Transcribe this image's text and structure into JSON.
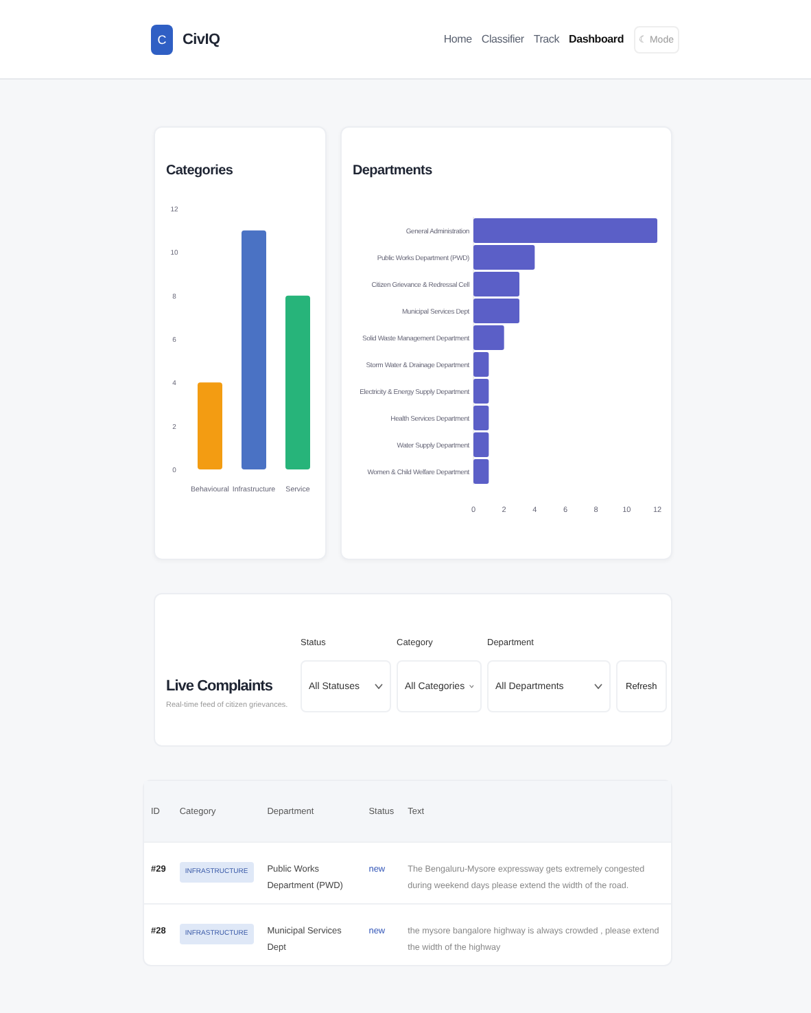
{
  "header": {
    "logo_letter": "C",
    "brand": "CivIQ",
    "nav": [
      {
        "label": "Home",
        "selected": false
      },
      {
        "label": "Classifier",
        "selected": false
      },
      {
        "label": "Track",
        "selected": false
      },
      {
        "label": "Dashboard",
        "selected": true
      }
    ],
    "mode_button": "☾ Mode"
  },
  "categories_chart": {
    "chart_data": {
      "type": "bar",
      "title": "Categories",
      "categories": [
        "Behavioural",
        "Infrastructure",
        "Service"
      ],
      "series": [
        {
          "color": "#f39c12",
          "values": [
            4,
            null,
            null
          ]
        },
        {
          "color": "#4a72c4",
          "values": [
            null,
            11,
            null
          ]
        },
        {
          "color": "#27b47a",
          "values": [
            null,
            null,
            8
          ]
        }
      ],
      "ylim": [
        0,
        12
      ],
      "yticks": [
        0,
        2,
        4,
        6,
        8,
        10,
        12
      ]
    }
  },
  "departments_chart": {
    "chart_data": {
      "type": "bar",
      "orientation": "horizontal",
      "title": "Departments",
      "categories": [
        "General Administration",
        "Public Works Department (PWD)",
        "Citizen Grievance & Redressal Cell",
        "Municipal Services Dept",
        "Solid Waste Management Department",
        "Storm Water & Drainage Department",
        "Electricity & Energy Supply Department",
        "Health Services Department",
        "Water Supply Department",
        "Women & Child Welfare Department"
      ],
      "series": [
        {
          "color": "#5b5fc7",
          "values": [
            12,
            4,
            3,
            3,
            2,
            1,
            1,
            1,
            1,
            1
          ]
        }
      ],
      "xlim": [
        0,
        12
      ],
      "xticks": [
        0,
        2,
        4,
        6,
        8,
        10,
        12
      ]
    }
  },
  "live": {
    "title": "Live Complaints",
    "subtitle": "Real-time feed of citizen grievances.",
    "filters": [
      {
        "label": "Status",
        "value": "All Statuses"
      },
      {
        "label": "Category",
        "value": "All Categories"
      },
      {
        "label": "Department",
        "value": "All Departments"
      }
    ],
    "refresh": "Refresh"
  },
  "table": {
    "columns": [
      "ID",
      "Category",
      "Department",
      "Status",
      "Text"
    ],
    "rows": [
      {
        "id": "#29",
        "category": "INFRASTRUCTURE",
        "department": "Public Works Department (PWD)",
        "status": "new",
        "text": "The Bengaluru-Mysore expressway gets extremely congested during weekend days please extend the width of the road."
      },
      {
        "id": "#28",
        "category": "INFRASTRUCTURE",
        "department": "Municipal Services Dept",
        "status": "new",
        "text": "the mysore bangalore highway is always crowded , please extend the width of the highway"
      }
    ]
  }
}
